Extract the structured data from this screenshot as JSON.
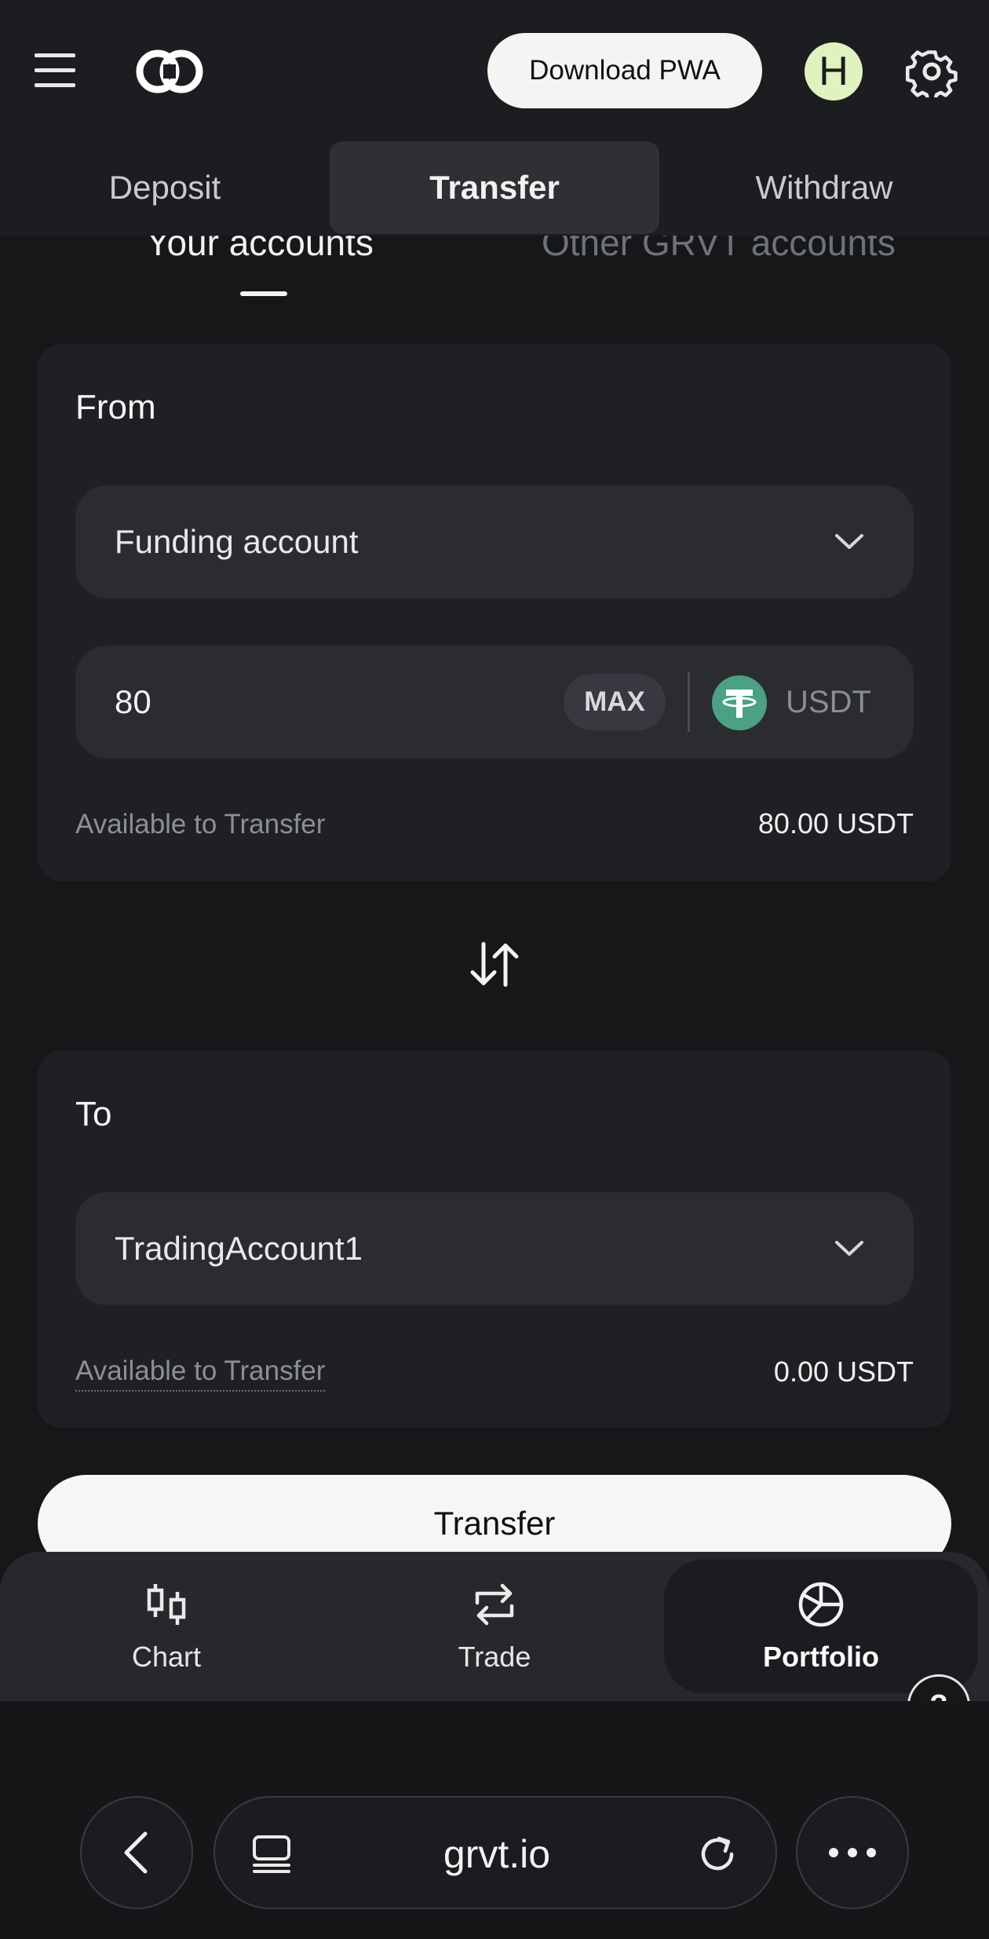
{
  "header": {
    "download_pwa": "Download PWA",
    "avatar_initial": "H"
  },
  "tabs": [
    "Deposit",
    "Transfer",
    "Withdraw"
  ],
  "subtabs": [
    "Your accounts",
    "Other GRVT accounts"
  ],
  "from": {
    "title": "From",
    "account": "Funding account",
    "amount": "80",
    "max_label": "MAX",
    "currency": "USDT",
    "available_label": "Available to Transfer",
    "available_value": "80.00 USDT"
  },
  "to": {
    "title": "To",
    "account": "TradingAccount1",
    "available_label": "Available to Transfer",
    "available_value": "0.00 USDT"
  },
  "transfer_button": "Transfer",
  "bottom_nav": [
    {
      "label": "Chart",
      "icon": "candlestick-icon"
    },
    {
      "label": "Trade",
      "icon": "repeat-icon"
    },
    {
      "label": "Portfolio",
      "icon": "pie-chart-icon",
      "active": true
    }
  ],
  "help": "?",
  "browser": {
    "url": "grvt.io"
  },
  "colors": {
    "background": "#161719",
    "card": "#1f2023",
    "input": "#2b2c30",
    "tether_green": "#4aa183"
  }
}
